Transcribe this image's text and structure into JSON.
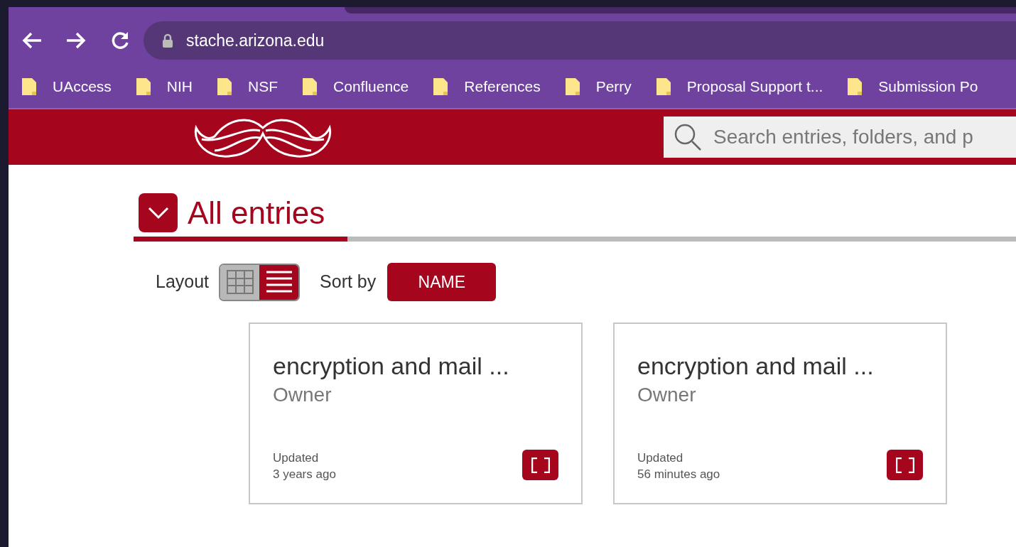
{
  "browser": {
    "url": "stache.arizona.edu",
    "bookmarks": [
      {
        "label": "UAccess"
      },
      {
        "label": "NIH"
      },
      {
        "label": "NSF"
      },
      {
        "label": "Confluence"
      },
      {
        "label": "References"
      },
      {
        "label": "Perry"
      },
      {
        "label": "Proposal Support t..."
      },
      {
        "label": "Submission Po"
      }
    ]
  },
  "header": {
    "search": {
      "placeholder": "Search entries, folders, and p"
    }
  },
  "section": {
    "title": "All entries",
    "expanded": true
  },
  "toolbar": {
    "layout_label": "Layout",
    "layout_options": [
      {
        "kind": "grid",
        "selected": false
      },
      {
        "kind": "list",
        "selected": true
      }
    ],
    "sort_label": "Sort by",
    "sort_value": "NAME"
  },
  "entries": [
    {
      "title": "encryption and mail ...",
      "role": "Owner",
      "updated_label": "Updated",
      "updated": "3 years ago"
    },
    {
      "title": "encryption and mail ...",
      "role": "Owner",
      "updated_label": "Updated",
      "updated": "56 minutes ago"
    }
  ]
}
